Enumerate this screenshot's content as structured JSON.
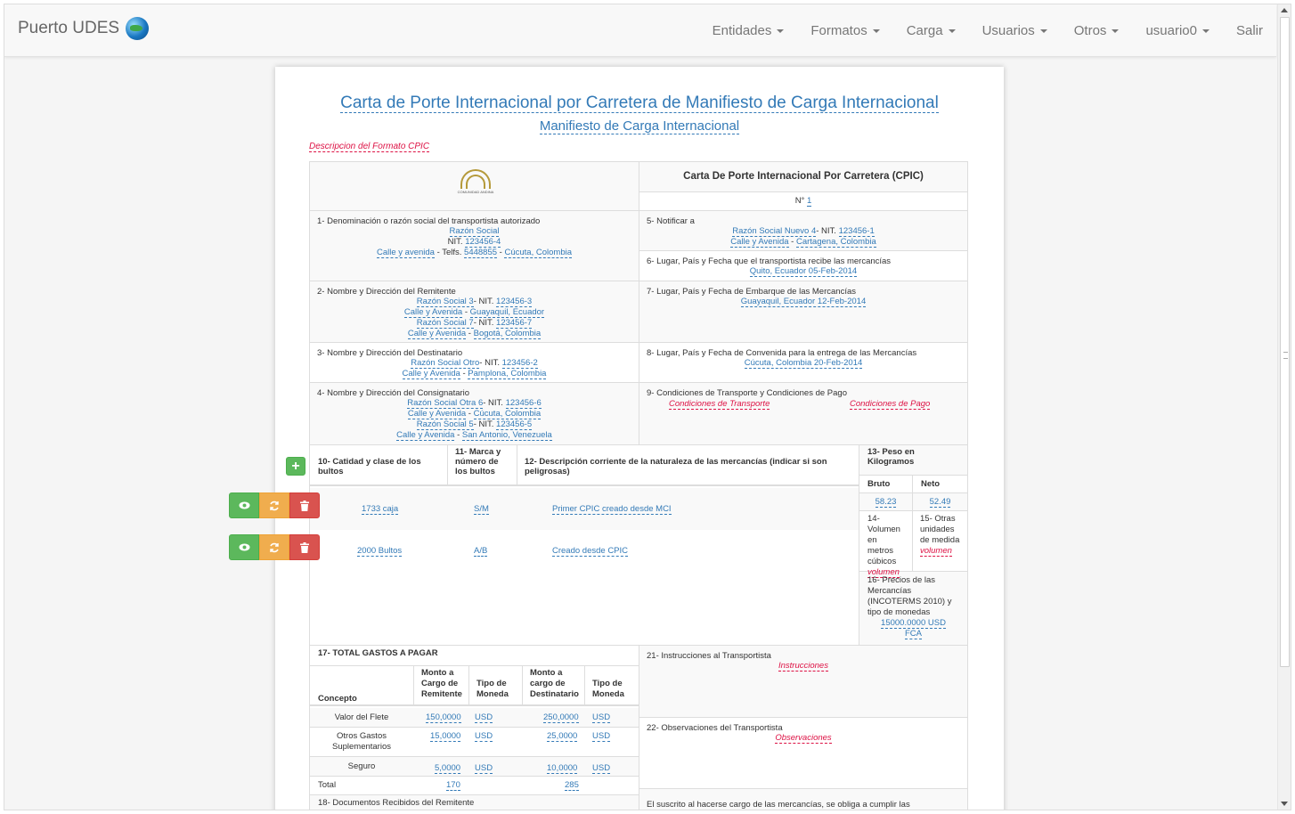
{
  "navbar": {
    "brand": "Puerto UDES",
    "menu": [
      "Entidades",
      "Formatos",
      "Carga",
      "Usuarios",
      "Otros",
      "usuario0"
    ],
    "logout": "Salir"
  },
  "doc": {
    "title": "Carta de Porte Internacional por Carretera de Manifiesto de Carga Internacional",
    "subtitle": "Manifiesto de Carga Internacional",
    "format_desc": "Descripcion del Formato CPIC",
    "logo_caption": "COMUNIDAD ANDINA",
    "cpic_title": "Carta De Porte Internacional Por Carretera (CPIC)",
    "number_label": "N°",
    "number": "1"
  },
  "s1": {
    "label": "1- Denominación o razón social del transportista autorizado",
    "razon": "Razón Social",
    "nit_label": "NIT.",
    "nit": "123456-4",
    "dir": "Calle y avenida",
    "tel_label": "- Telfs.",
    "tel": "5448855",
    "city": "Cúcuta, Colombia"
  },
  "s2": {
    "label": "2- Nombre y Dirección del Remitente",
    "r1": "Razón Social 3",
    "n1": "123456-3",
    "d1": "Calle y Avenida",
    "c1": "Guayaquil, Ecuador",
    "r2": "Razón Social 7",
    "n2": "123456-7",
    "d2": "Calle y Avenida",
    "c2": "Bogotá, Colombia"
  },
  "s3": {
    "label": "3- Nombre y Dirección del Destinatario",
    "r1": "Razón Social Otro",
    "n1": "123456-2",
    "d1": "Calle y Avenida",
    "c1": "Pamplona, Colombia"
  },
  "s4": {
    "label": "4- Nombre y Dirección del Consignatario",
    "r1": "Razón Social Otra 6",
    "n1": "123456-6",
    "d1": "Calle y Avenida",
    "c1": "Cúcuta, Colombia",
    "r2": "Razón Social 5",
    "n2": "123456-5",
    "d2": "Calle y Avenida",
    "c2": "San Antonio, Venezuela"
  },
  "s5": {
    "label": "5- Notificar a",
    "r1": "Razón Social Nuevo 4",
    "n1": "123456-1",
    "d1": "Calle y Avenida",
    "c1": "Cartagena, Colombia"
  },
  "s6": {
    "label": "6- Lugar, País y Fecha que el transportista recibe las mercancías",
    "value": "Quito, Ecuador 05-Feb-2014"
  },
  "s7": {
    "label": "7- Lugar, País y Fecha de Embarque de las Mercancías",
    "value": "Guayaquil, Ecuador 12-Feb-2014"
  },
  "s8": {
    "label": "8- Lugar, País y Fecha de Convenida para la entrega de las Mercancías",
    "value": "Cúcuta, Colombia 20-Feb-2014"
  },
  "s9": {
    "label": "9- Condiciones de Transporte y Condiciones de Pago",
    "transporte": "Condiciones de Transporte",
    "pago": "Condiciones de Pago"
  },
  "goods": {
    "h10": "10- Catidad y clase de los bultos",
    "h11": "11- Marca y número de los bultos",
    "h12": "12- Descripción corriente de la naturaleza de las mercancías (indicar si son peligrosas)",
    "rows": [
      {
        "qty": "1733 caja",
        "mark": "S/M",
        "desc": "Primer CPIC creado desde MCI"
      },
      {
        "qty": "2000 Bultos",
        "mark": "A/B",
        "desc": "Creado desde CPIC"
      }
    ]
  },
  "weights": {
    "h13": "13- Peso en Kilogramos",
    "bruto_label": "Bruto",
    "neto_label": "Neto",
    "bruto": "58.23",
    "neto": "52.49",
    "h14": "14- Volumen en metros cúbicos",
    "v14": "volumen",
    "h15": "15- Otras unidades de medida",
    "v15": "volumen",
    "h16": "16- Precios de las Mercancías (INCOTERMS 2010) y tipo de monedas",
    "v16a": "15000.0000 USD",
    "v16b": "FCA"
  },
  "costs": {
    "title": "17- TOTAL GASTOS A PAGAR",
    "headers": [
      "Concepto",
      "Monto a Cargo de Remitente",
      "Tipo de Moneda",
      "Monto a cargo de Destinatario",
      "Tipo de Moneda"
    ],
    "rows": [
      {
        "concept": "Valor del Flete",
        "rem": "150,0000",
        "rcur": "USD",
        "dest": "250,0000",
        "dcur": "USD"
      },
      {
        "concept": "Otros Gastos Suplementarios",
        "rem": "15,0000",
        "rcur": "USD",
        "dest": "25,0000",
        "dcur": "USD"
      },
      {
        "concept": "Seguro",
        "rem": "5,0000",
        "rcur": "USD",
        "dest": "10,0000",
        "dcur": "USD"
      }
    ],
    "total_label": "Total",
    "total_rem": "170",
    "total_dest": "285"
  },
  "s18": {
    "label": "18- Documentos Recibidos del Remitente"
  },
  "s21": {
    "label": "21- Instrucciones al Transportista",
    "value": "Instrucciones"
  },
  "s22": {
    "label": "22- Observaciones del Transportista",
    "value": "Observaciones"
  },
  "s23": {
    "text": "El suscrito al hacerse cargo de las mercancías, se obliga a cumplir las"
  }
}
